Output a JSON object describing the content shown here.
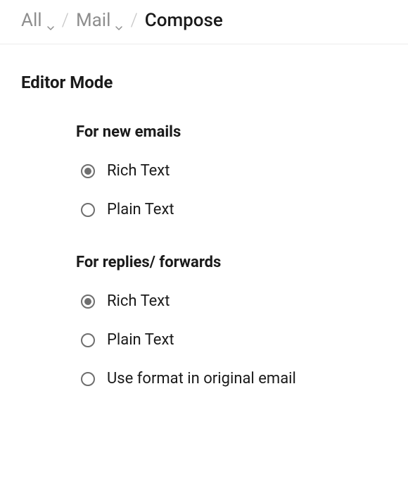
{
  "breadcrumb": {
    "items": [
      {
        "label": "All",
        "dropdown": true
      },
      {
        "label": "Mail",
        "dropdown": true
      }
    ],
    "current": "Compose"
  },
  "section": {
    "title": "Editor Mode"
  },
  "groups": [
    {
      "title": "For new emails",
      "options": [
        {
          "label": "Rich Text",
          "selected": true
        },
        {
          "label": "Plain Text",
          "selected": false
        }
      ]
    },
    {
      "title": "For replies/ forwards",
      "options": [
        {
          "label": "Rich Text",
          "selected": true
        },
        {
          "label": "Plain Text",
          "selected": false
        },
        {
          "label": "Use format in original email",
          "selected": false
        }
      ]
    }
  ]
}
